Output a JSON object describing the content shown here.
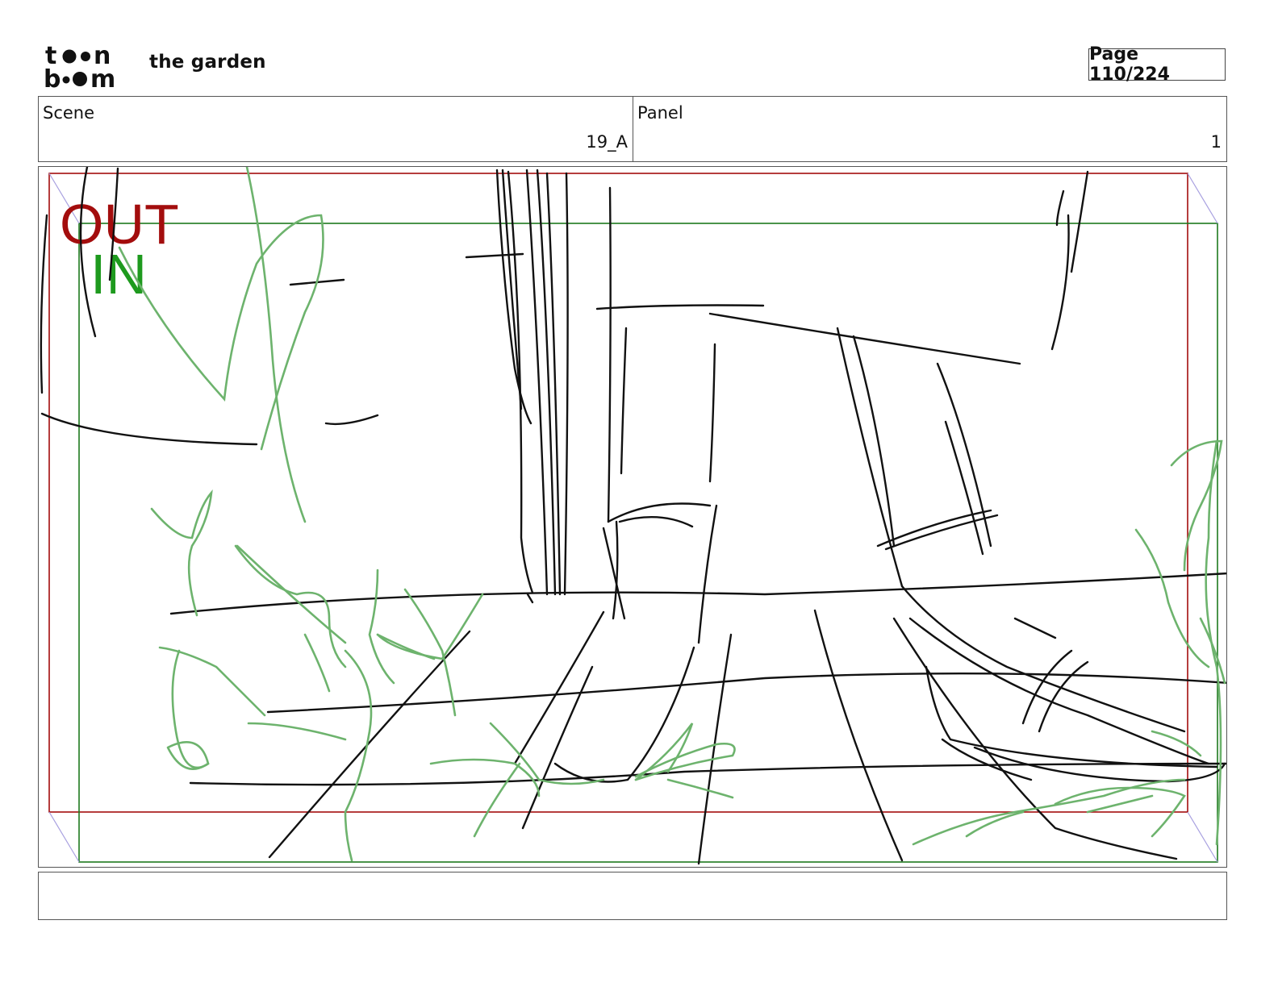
{
  "header": {
    "logo_text": "toon boom",
    "project_title": "the garden",
    "page_label": "Page 110/224"
  },
  "info": {
    "scene_label": "Scene",
    "scene_value": "19_A",
    "panel_label": "Panel",
    "panel_value": "1"
  },
  "frame": {
    "out_label": "OUT",
    "in_label": "IN",
    "colors": {
      "out": "#a30d0d",
      "in": "#1e9a1e",
      "ink": "#111111",
      "plants": "#6db36d",
      "field_arrows": "#a8a0e0"
    }
  },
  "notes": {
    "dialogue": ""
  }
}
